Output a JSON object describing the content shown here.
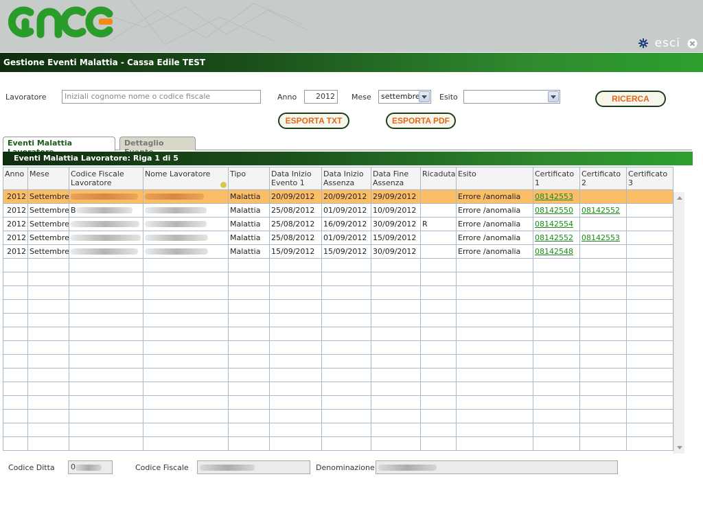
{
  "header": {
    "logo_text": "ance",
    "exit_label": "esci",
    "page_title": "Gestione Eventi Malattia - Cassa Edile TEST"
  },
  "filters": {
    "lavoratore_label": "Lavoratore",
    "lavoratore_placeholder": "Iniziali cognome nome o codice fiscale",
    "anno_label": "Anno",
    "anno_value": "2012",
    "mese_label": "Mese",
    "mese_value": "settembre",
    "esito_label": "Esito",
    "esito_value": "",
    "ricerca_button": "RICERCA",
    "export_txt_button": "ESPORTA TXT",
    "export_pdf_button": "ESPORTA PDF"
  },
  "tabs": [
    {
      "label": "Eventi Malattia Lavoratore",
      "active": true
    },
    {
      "label": "Dettaglio Evento",
      "active": false
    }
  ],
  "grid": {
    "title": "Eventi Malattia Lavoratore: Riga 1 di 5",
    "columns": [
      "Anno",
      "Mese",
      "Codice Fiscale Lavoratore",
      "Nome Lavoratore",
      "Tipo",
      "Data Inizio Evento 1",
      "Data Inizio Assenza",
      "Data Fine Assenza",
      "Ricaduta",
      "Esito",
      "Certificato 1",
      "Certificato 2",
      "Certificato 3"
    ],
    "rows": [
      {
        "anno": "2012",
        "mese": "Settembre",
        "cf": "",
        "nome": "",
        "tipo": "Malattia",
        "inizio_evento": "20/09/2012",
        "inizio_assenza": "20/09/2012",
        "fine_assenza": "29/09/2012",
        "ricaduta": "",
        "esito": "Errore /anomalia",
        "cert1": "08142553",
        "cert2": "",
        "cert3": ""
      },
      {
        "anno": "2012",
        "mese": "Settembre",
        "cf": "B",
        "nome": "",
        "tipo": "Malattia",
        "inizio_evento": "25/08/2012",
        "inizio_assenza": "01/09/2012",
        "fine_assenza": "10/09/2012",
        "ricaduta": "",
        "esito": "Errore /anomalia",
        "cert1": "08142550",
        "cert2": "08142552",
        "cert3": ""
      },
      {
        "anno": "2012",
        "mese": "Settembre",
        "cf": "",
        "nome": "",
        "tipo": "Malattia",
        "inizio_evento": "25/08/2012",
        "inizio_assenza": "16/09/2012",
        "fine_assenza": "30/09/2012",
        "ricaduta": "R",
        "esito": "Errore /anomalia",
        "cert1": "08142554",
        "cert2": "",
        "cert3": ""
      },
      {
        "anno": "2012",
        "mese": "Settembre",
        "cf": "",
        "nome": "",
        "tipo": "Malattia",
        "inizio_evento": "25/08/2012",
        "inizio_assenza": "01/09/2012",
        "fine_assenza": "15/09/2012",
        "ricaduta": "",
        "esito": "Errore /anomalia",
        "cert1": "08142552",
        "cert2": "08142553",
        "cert3": ""
      },
      {
        "anno": "2012",
        "mese": "Settembre",
        "cf": "",
        "nome": "",
        "tipo": "Malattia",
        "inizio_evento": "15/09/2012",
        "inizio_assenza": "15/09/2012",
        "fine_assenza": "30/09/2012",
        "ricaduta": "",
        "esito": "Errore /anomalia",
        "cert1": "08142548",
        "cert2": "",
        "cert3": ""
      }
    ],
    "selected_row": 0
  },
  "footer": {
    "codice_ditta_label": "Codice Ditta",
    "codice_ditta_value": "0",
    "codice_fiscale_label": "Codice Fiscale",
    "codice_fiscale_value": "",
    "denominazione_label": "Denominazione",
    "denominazione_value": ""
  },
  "colors": {
    "accent_green": "#2ea02e",
    "dark_green": "#0f2d0f",
    "selected_row": "#fbbd66",
    "button_text": "#e2671a",
    "link": "#1a8a1a"
  }
}
